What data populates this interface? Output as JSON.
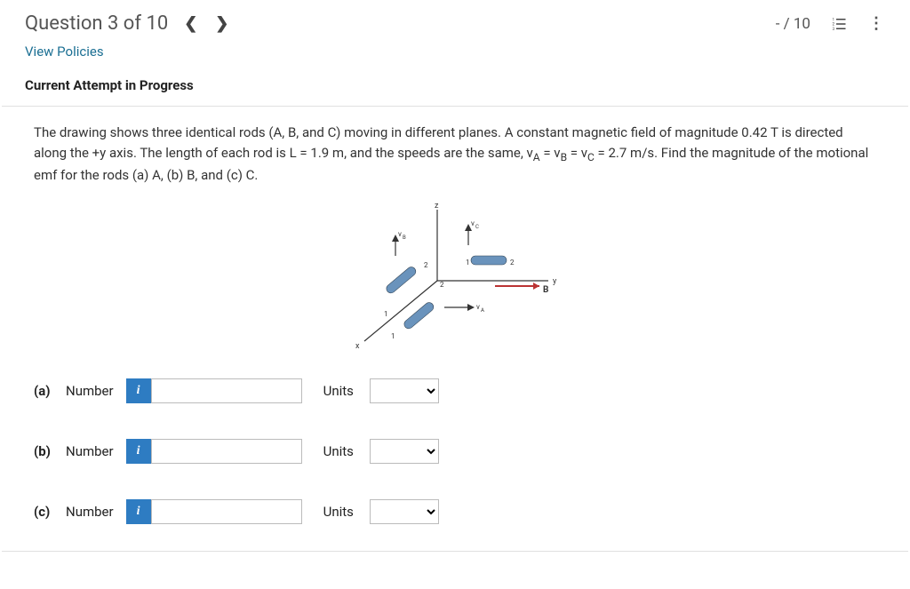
{
  "header": {
    "question_title": "Question 3 of 10",
    "score": "- / 10"
  },
  "links": {
    "view_policies": "View Policies"
  },
  "progress_label": "Current Attempt in Progress",
  "question": {
    "text_before": "The drawing shows three identical rods (A, B, and C) moving in different planes. A constant magnetic field of magnitude 0.42 T is directed along the +y axis. The length of each rod is L = 1.9 m, and the speeds are the same, v",
    "sub_a": "A",
    "eq1": " = v",
    "sub_b": "B",
    "eq2": " = v",
    "sub_c": "C",
    "text_after": " = 2.7 m/s. Find the magnitude of the motional emf for the rods (a) A, (b) B, and (c) C."
  },
  "figure": {
    "labels": {
      "z": "z",
      "y": "y",
      "x": "x",
      "origin": "2",
      "one": "1",
      "two": "2",
      "vA": "vA",
      "vB": "vB",
      "vC": "vC",
      "B": "B"
    }
  },
  "answers": {
    "a": {
      "part": "(a)",
      "number_label": "Number",
      "units_label": "Units",
      "value": "",
      "units": ""
    },
    "b": {
      "part": "(b)",
      "number_label": "Number",
      "units_label": "Units",
      "value": "",
      "units": ""
    },
    "c": {
      "part": "(c)",
      "number_label": "Number",
      "units_label": "Units",
      "value": "",
      "units": ""
    }
  },
  "info_glyph": "i"
}
